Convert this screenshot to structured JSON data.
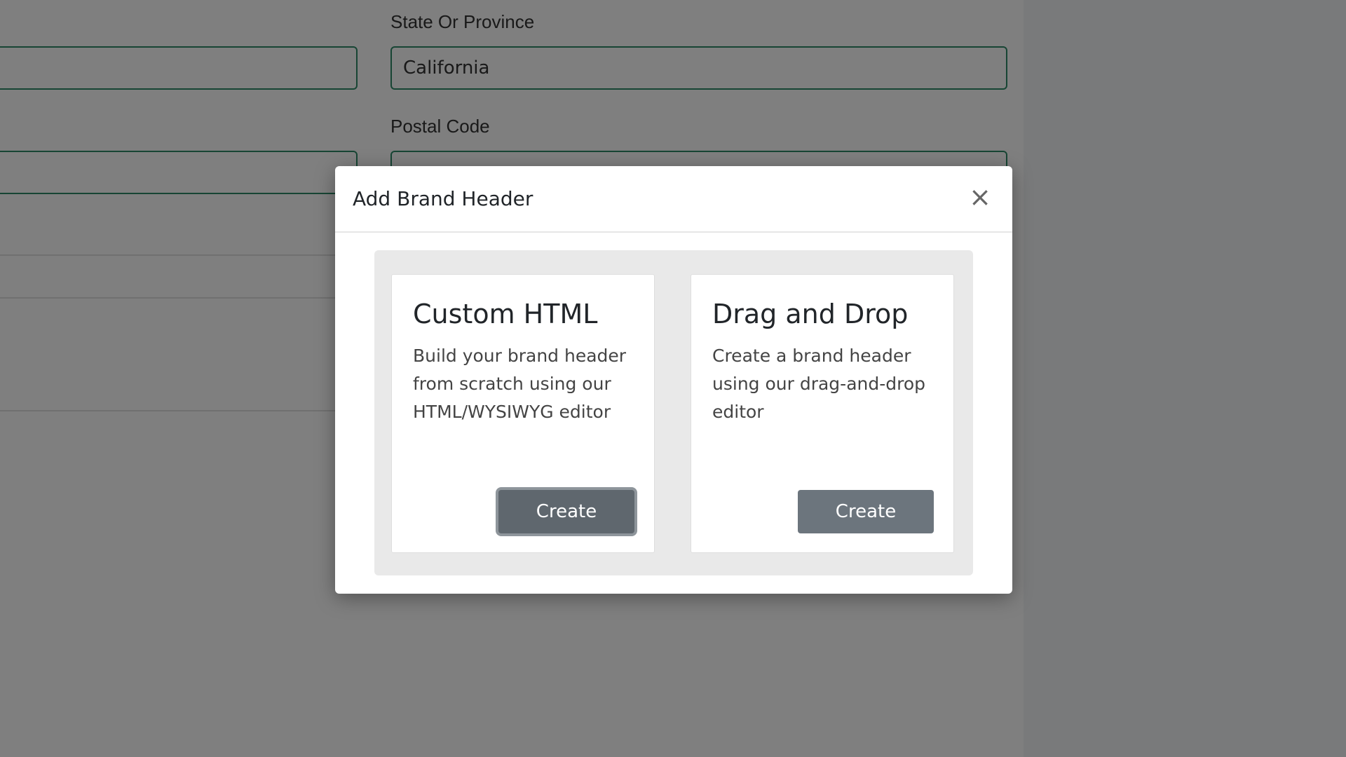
{
  "background_form": {
    "state_label": "State Or Province",
    "state_value": "California",
    "postal_label": "Postal Code",
    "postal_value": ""
  },
  "modal": {
    "title": "Add Brand Header",
    "close_glyph": "×",
    "options": [
      {
        "title": "Custom HTML",
        "description": "Build your brand header from scratch using our HTML/WYSIWYG editor",
        "button_label": "Create"
      },
      {
        "title": "Drag and Drop",
        "description": "Create a brand header using our drag-and-drop editor",
        "button_label": "Create"
      }
    ]
  },
  "colors": {
    "input_border": "#2f8a68",
    "button": "#6c757d",
    "overlay": "rgba(0,0,0,0.5)"
  }
}
